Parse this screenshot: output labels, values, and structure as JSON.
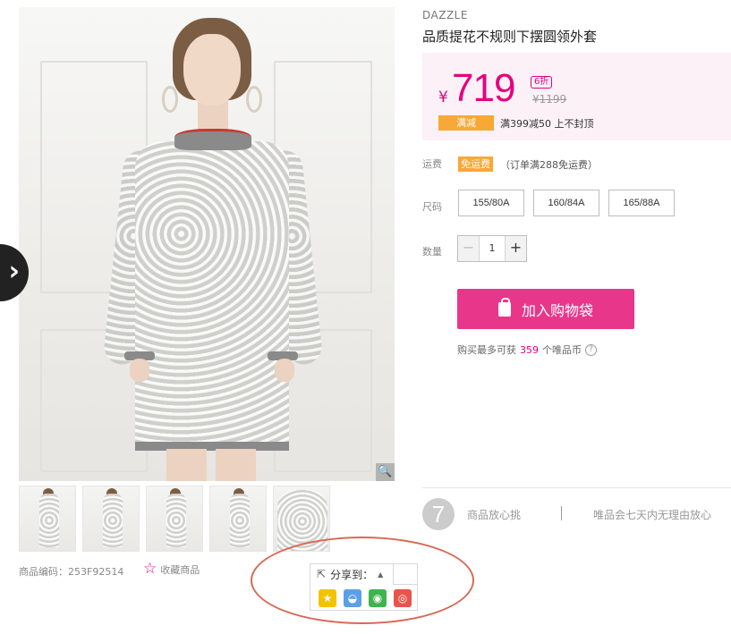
{
  "product": {
    "brand": "DAZZLE",
    "title": "品质提花不规则下摆圆领外套",
    "sku_label": "商品编码：253F92514",
    "favorite_label": "收藏商品"
  },
  "price": {
    "currency": "¥",
    "current": "719",
    "discount_badge": "6折",
    "original": "¥1199",
    "promo_tag": "满减",
    "promo_text": "满399减50 上不封顶"
  },
  "shipping": {
    "label": "运费",
    "tag": "免运费",
    "note": "（订单满288免运费）"
  },
  "size": {
    "label": "尺码",
    "options": [
      "155/80A",
      "160/84A",
      "165/88A"
    ]
  },
  "quantity": {
    "label": "数量",
    "minus": "−",
    "value": "1",
    "plus": "+"
  },
  "cart": {
    "button_label": "加入购物袋",
    "coin_prefix": "购买最多可获",
    "coin_count": "359",
    "coin_suffix": "个唯品币",
    "help": "?"
  },
  "guarantee": {
    "badge": "7",
    "title": "商品放心挑",
    "note": "唯品会七天内无理由放心"
  },
  "share": {
    "label": "分享到：",
    "icons": [
      "qzone-icon",
      "qq-icon",
      "wechat-icon",
      "weibo-icon"
    ]
  },
  "gallery": {
    "thumbnails": 5,
    "zoom": "🔍"
  },
  "colors": {
    "accent": "#e4007f",
    "cart_button": "#e8368b",
    "promo": "#f7a837",
    "price_panel_bg": "#fcf1f7"
  }
}
